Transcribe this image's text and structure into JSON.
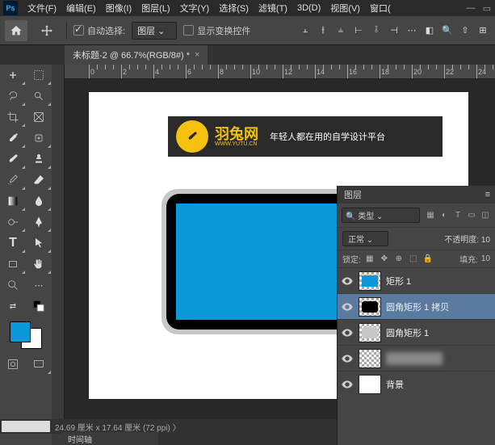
{
  "menu": {
    "items": [
      "文件(F)",
      "编辑(E)",
      "图像(I)",
      "图层(L)",
      "文字(Y)",
      "选择(S)",
      "滤镜(T)",
      "3D(D)",
      "视图(V)",
      "窗口("
    ]
  },
  "options": {
    "auto_select": "自动选择:",
    "layer_dropdown": "图层",
    "show_transform": "显示变换控件"
  },
  "doc_tab": {
    "title": "未标题-2 @ 66.7%(RGB/8#) *"
  },
  "ruler": {
    "marks": [
      0,
      2,
      4,
      6,
      8,
      10,
      12,
      14,
      16,
      18,
      20,
      22,
      24
    ]
  },
  "watermark": {
    "title": "羽兔网",
    "url": "WWW.YUTU.CN",
    "tagline": "年轻人都在用的自学设计平台"
  },
  "status": {
    "dims": "24.69 厘米 x 17.64 厘米 (72 ppi)",
    "arrow": "〉"
  },
  "timeline": {
    "label": "时间轴"
  },
  "layers_panel": {
    "title": "图层",
    "search_label": "类型",
    "blend_mode": "正常",
    "opacity_label": "不透明度:",
    "opacity_value": "10",
    "lock_label": "锁定:",
    "fill_label": "填充:",
    "fill_value": "10",
    "layers": [
      {
        "name": "矩形 1",
        "thumb_bg": "#0a99d8",
        "selected": false
      },
      {
        "name": "圆角矩形 1 拷贝",
        "thumb_bg": "#000000",
        "selected": true
      },
      {
        "name": "圆角矩形 1",
        "thumb_bg": "#c8c8c8",
        "selected": false
      },
      {
        "name": "",
        "thumb_bg": "blur",
        "selected": false
      },
      {
        "name": "背景",
        "thumb_bg": "#ffffff",
        "selected": false
      }
    ]
  },
  "colors": {
    "fg": "#0a99d8",
    "bg": "#ffffff"
  }
}
